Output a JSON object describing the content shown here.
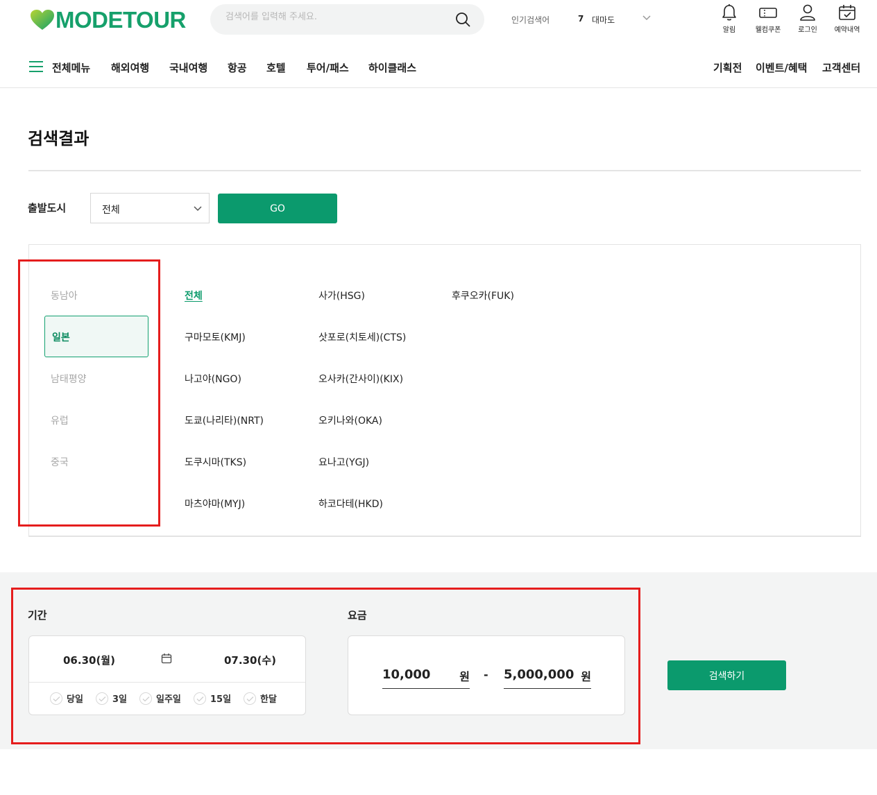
{
  "header": {
    "logo_text": "MODETOUR",
    "search_placeholder": "검색어를 입력해 주세요.",
    "popular_label": "인기검색어",
    "popular_rank": "7",
    "popular_keyword": "대마도",
    "utilities": [
      {
        "label": "알림",
        "icon": "bell-icon"
      },
      {
        "label": "웰컴쿠폰",
        "icon": "coupon-icon"
      },
      {
        "label": "로그인",
        "icon": "user-icon"
      },
      {
        "label": "예약내역",
        "icon": "calendar-check-icon"
      }
    ]
  },
  "nav": {
    "all_menu": "전체메뉴",
    "items": [
      "해외여행",
      "국내여행",
      "항공",
      "호텔",
      "투어/패스",
      "하이클래스"
    ],
    "right_items": [
      "기획전",
      "이벤트/혜택",
      "고객센터"
    ]
  },
  "page": {
    "title": "검색결과"
  },
  "departure": {
    "label": "출발도시",
    "selected": "전체",
    "go_label": "GO"
  },
  "regions": {
    "items": [
      "동남아",
      "일본",
      "남태평양",
      "유럽",
      "중국"
    ],
    "active": "일본"
  },
  "cities": {
    "col1": [
      "전체",
      "구마모토(KMJ)",
      "나고야(NGO)",
      "도쿄(나리타)(NRT)",
      "도쿠시마(TKS)",
      "마츠야마(MYJ)"
    ],
    "col2": [
      "사가(HSG)",
      "삿포로(치토세)(CTS)",
      "오사카(간사이)(KIX)",
      "오키나와(OKA)",
      "요나고(YGJ)",
      "하코다테(HKD)"
    ],
    "col3": [
      "후쿠오카(FUK)"
    ]
  },
  "period": {
    "label": "기간",
    "start": "06.30(월)",
    "end": "07.30(수)",
    "chips": [
      "당일",
      "3일",
      "일주일",
      "15일",
      "한달"
    ]
  },
  "price": {
    "label": "요금",
    "min": "10,000",
    "max": "5,000,000",
    "unit": "원",
    "dash": "-"
  },
  "search_button": "검색하기",
  "colors": {
    "brand": "#16a06b",
    "button": "#0b9a6d",
    "highlight_box": "#e51d1d"
  }
}
